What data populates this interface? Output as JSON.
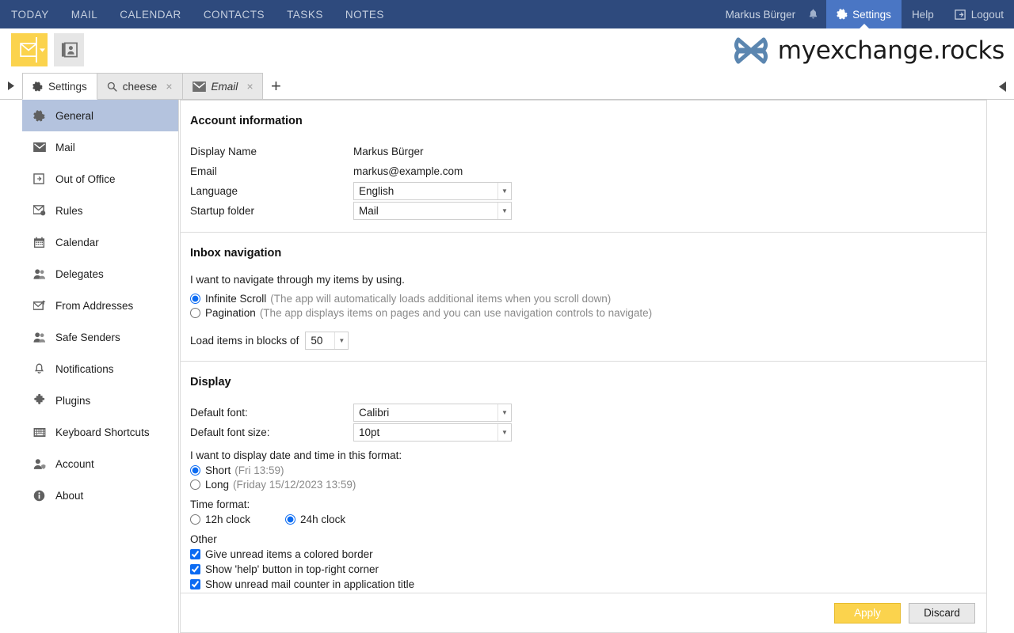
{
  "topbar": {
    "nav": [
      {
        "label": "TODAY",
        "name": "topnav-today"
      },
      {
        "label": "MAIL",
        "name": "topnav-mail"
      },
      {
        "label": "CALENDAR",
        "name": "topnav-calendar"
      },
      {
        "label": "CONTACTS",
        "name": "topnav-contacts"
      },
      {
        "label": "TASKS",
        "name": "topnav-tasks"
      },
      {
        "label": "NOTES",
        "name": "topnav-notes"
      }
    ],
    "username": "Markus Bürger",
    "settings_label": "Settings",
    "help_label": "Help",
    "logout_label": "Logout",
    "bg_color": "#2e4a7d",
    "active_tab_color": "#4a76c4"
  },
  "brand": {
    "name": "myexchange.rocks",
    "logo_color": "#5b86b0"
  },
  "tabs": {
    "items": [
      {
        "label": "Settings",
        "icon": "gear-icon",
        "active": true,
        "closable": false,
        "italic": false
      },
      {
        "label": "cheese",
        "icon": "search-icon",
        "active": false,
        "closable": true,
        "italic": false
      },
      {
        "label": "Email",
        "icon": "envelope-icon",
        "active": false,
        "closable": true,
        "italic": true
      }
    ],
    "add_label": "+",
    "close_label": "×"
  },
  "sidebar": {
    "items": [
      {
        "label": "General",
        "icon": "gear-icon",
        "active": true
      },
      {
        "label": "Mail",
        "icon": "envelope-icon",
        "active": false
      },
      {
        "label": "Out of Office",
        "icon": "exit-arrow-icon",
        "active": false
      },
      {
        "label": "Rules",
        "icon": "envelope-rules-icon",
        "active": false
      },
      {
        "label": "Calendar",
        "icon": "calendar-icon",
        "active": false
      },
      {
        "label": "Delegates",
        "icon": "people-icon",
        "active": false
      },
      {
        "label": "From Addresses",
        "icon": "envelope-from-icon",
        "active": false
      },
      {
        "label": "Safe Senders",
        "icon": "people-shield-icon",
        "active": false
      },
      {
        "label": "Notifications",
        "icon": "bell-icon",
        "active": false
      },
      {
        "label": "Plugins",
        "icon": "puzzle-icon",
        "active": false
      },
      {
        "label": "Keyboard Shortcuts",
        "icon": "keyboard-icon",
        "active": false
      },
      {
        "label": "Account",
        "icon": "person-shield-icon",
        "active": false
      },
      {
        "label": "About",
        "icon": "info-icon",
        "active": false
      }
    ]
  },
  "account_section": {
    "title": "Account information",
    "display_name_label": "Display Name",
    "display_name_value": "Markus Bürger",
    "email_label": "Email",
    "email_value": "markus@example.com",
    "language_label": "Language",
    "language_value": "English",
    "startup_folder_label": "Startup folder",
    "startup_folder_value": "Mail"
  },
  "inbox_section": {
    "title": "Inbox navigation",
    "prompt": "I want to navigate through my items by using.",
    "infinite_label": "Infinite Scroll",
    "infinite_hint": "(The app will automatically loads additional items when you scroll down)",
    "infinite_selected": true,
    "pagination_label": "Pagination",
    "pagination_hint": "(The app displays items on pages and you can use navigation controls to navigate)",
    "pagination_selected": false,
    "blocks_label": "Load items in blocks of",
    "blocks_value": "50"
  },
  "display_section": {
    "title": "Display",
    "font_label": "Default font:",
    "font_value": "Calibri",
    "font_size_label": "Default font size:",
    "font_size_value": "10pt",
    "datetime_prompt": "I want to display date and time in this format:",
    "short_label": "Short",
    "short_hint": "(Fri 13:59)",
    "short_selected": true,
    "long_label": "Long",
    "long_hint": "(Friday 15/12/2023 13:59)",
    "long_selected": false,
    "time_format_label": "Time format:",
    "clock_12_label": "12h clock",
    "clock_12_selected": false,
    "clock_24_label": "24h clock",
    "clock_24_selected": true,
    "other_label": "Other",
    "checkboxes": [
      {
        "label": "Give unread items a colored border",
        "checked": true
      },
      {
        "label": "Show 'help' button in top-right corner",
        "checked": true
      },
      {
        "label": "Show unread mail counter in application title",
        "checked": true
      }
    ]
  },
  "footer": {
    "apply_label": "Apply",
    "discard_label": "Discard",
    "apply_color": "#fbd34d"
  }
}
